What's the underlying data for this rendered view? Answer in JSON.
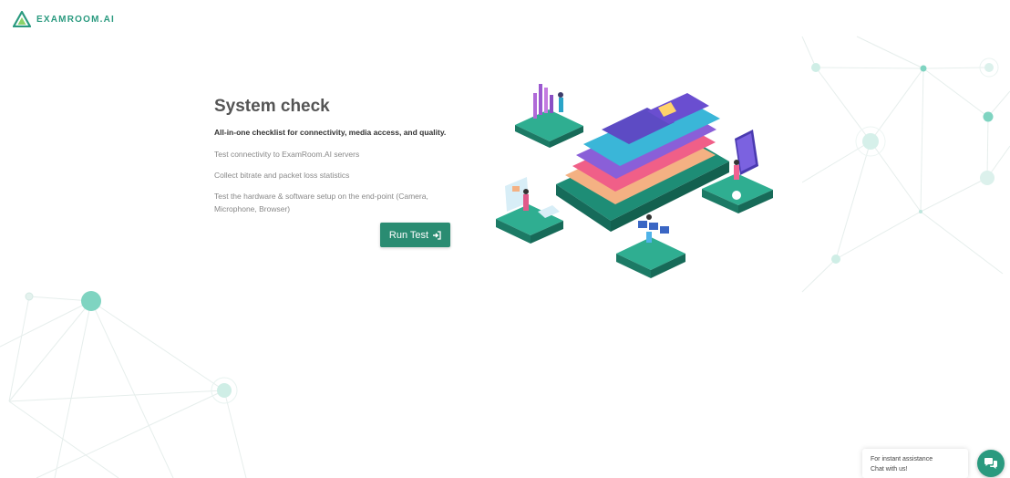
{
  "header": {
    "brand_name": "EXAMROOM.AI"
  },
  "main": {
    "title": "System check",
    "subtitle": "All-in-one checklist for connectivity, media access, and quality.",
    "features": [
      "Test connectivity to ExamRoom.AI servers",
      "Collect bitrate and packet loss statistics",
      "Test the hardware & software setup on the end-point (Camera, Microphone, Browser)"
    ],
    "run_button_label": "Run Test",
    "run_button_icon": "sign-in-icon"
  },
  "chat_widget": {
    "line1": "For instant assistance",
    "line2": "Chat with us!",
    "icon": "chat-bubbles-icon"
  },
  "colors": {
    "brand_teal": "#2a9a7f",
    "button_green": "#2a8c72",
    "network_node": "#7fd4c1"
  }
}
